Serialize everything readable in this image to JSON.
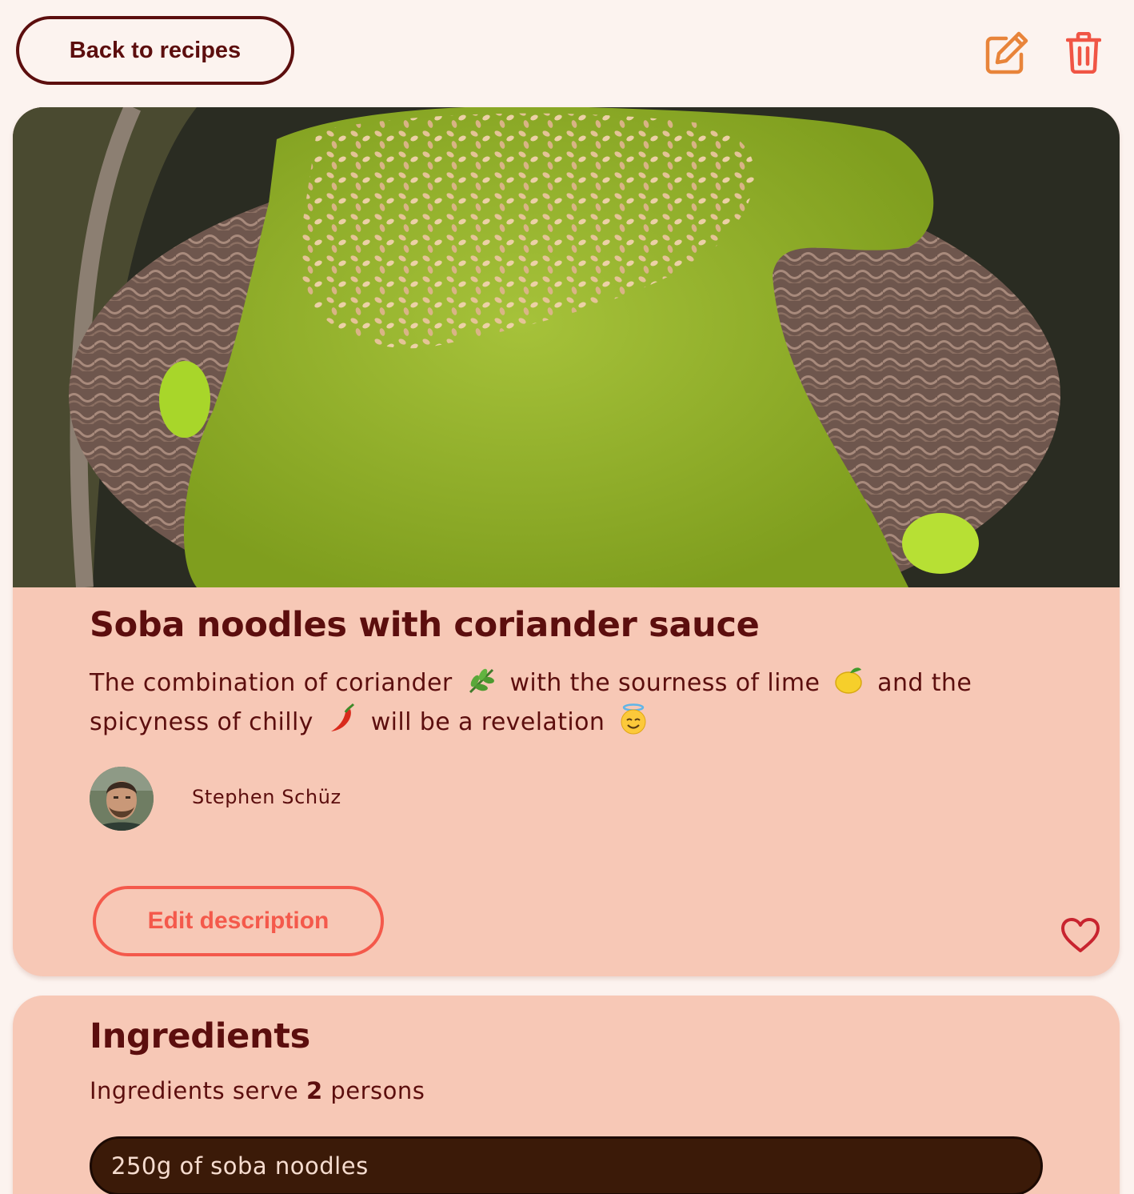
{
  "header": {
    "back_label": "Back to recipes",
    "edit_icon": "edit-icon",
    "delete_icon": "trash-icon"
  },
  "recipe": {
    "title": "Soba noodles with coriander sauce",
    "description": {
      "part1": "The combination of coriander",
      "emoji1": "herb-emoji",
      "part2": "with the sourness of lime",
      "emoji2": "lemon-emoji",
      "part3": "and the spicyness of chilly",
      "emoji3": "chili-emoji",
      "part4": "will be a revelation",
      "emoji4": "halo-smile-emoji"
    },
    "author": {
      "name": "Stephen Schüz"
    },
    "edit_description_label": "Edit description",
    "favorite_icon": "heart-icon"
  },
  "ingredients": {
    "title": "Ingredients",
    "serve_prefix": "Ingredients serve",
    "serve_count": "2",
    "serve_suffix": "persons",
    "items": [
      "250g of soba noodles"
    ]
  },
  "colors": {
    "page_bg": "#fcf3ef",
    "card_bg": "#f7c8b6",
    "text_primary": "#5c0e0e",
    "accent_red": "#f4594b",
    "edit_icon_orange": "#e8843a",
    "trash_icon_red": "#f05545",
    "ingredient_pill_bg": "#3b1a08"
  }
}
